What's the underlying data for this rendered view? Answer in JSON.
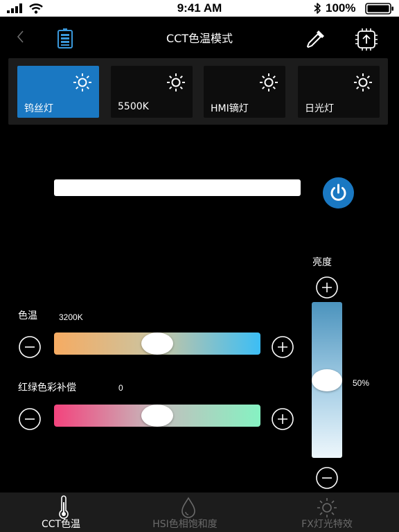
{
  "status_bar": {
    "time": "9:41 AM",
    "battery_percent": "100%"
  },
  "nav": {
    "title": "CCT色温模式"
  },
  "presets": [
    {
      "label": "钨丝灯",
      "active": true
    },
    {
      "label": "5500K",
      "active": false
    },
    {
      "label": "HMI镝灯",
      "active": false
    },
    {
      "label": "日光灯",
      "active": false
    }
  ],
  "preview": {
    "color": "#ffffff",
    "power_color": "#1a78c2"
  },
  "cct": {
    "label": "色温",
    "value": "3200K",
    "position": 0.5
  },
  "gm": {
    "label": "红绿色彩补偿",
    "value": "0",
    "position": 0.5
  },
  "brightness": {
    "label": "亮度",
    "value": "50%",
    "position": 0.5
  },
  "tabs": [
    {
      "label": "CCT色温",
      "icon": "thermometer-icon",
      "active": true
    },
    {
      "label": "HSI色相饱和度",
      "icon": "droplet-icon",
      "active": false
    },
    {
      "label": "FX灯光特效",
      "icon": "sun-icon",
      "active": false
    }
  ],
  "colors": {
    "accent": "#1a78c2",
    "panel": "#1c1c1c",
    "inactive_text": "#6a6a6a"
  }
}
